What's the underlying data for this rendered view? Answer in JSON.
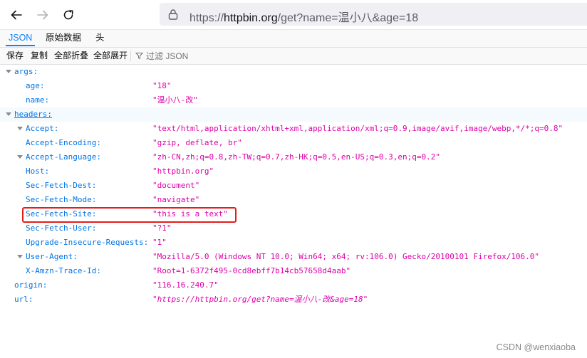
{
  "browser": {
    "url_prefix": "https://",
    "url_host": "httpbin.org",
    "url_path": "/get?name=温小八&age=18"
  },
  "tabs": {
    "json": "JSON",
    "raw": "原始数据",
    "headers": "头"
  },
  "actions": {
    "save": "保存",
    "copy": "复制",
    "collapse_all": "全部折叠",
    "expand_all": "全部展开",
    "filter_placeholder": "过滤 JSON"
  },
  "json": {
    "args_key": "args:",
    "args": [
      {
        "key": "age:",
        "value": "\"18\""
      },
      {
        "key": "name:",
        "value": "\"温小八-改\""
      }
    ],
    "headers_key": "headers:",
    "headers": [
      {
        "key": "Accept:",
        "value": "\"text/html,application/xhtml+xml,application/xml;q=0.9,image/avif,image/webp,*/*;q=0.8\""
      },
      {
        "key": "Accept-Encoding:",
        "value": "\"gzip, deflate, br\""
      },
      {
        "key": "Accept-Language:",
        "value": "\"zh-CN,zh;q=0.8,zh-TW;q=0.7,zh-HK;q=0.5,en-US;q=0.3,en;q=0.2\""
      },
      {
        "key": "Host:",
        "value": "\"httpbin.org\""
      },
      {
        "key": "Sec-Fetch-Dest:",
        "value": "\"document\""
      },
      {
        "key": "Sec-Fetch-Mode:",
        "value": "\"navigate\""
      },
      {
        "key": "Sec-Fetch-Site:",
        "value": "\"this is a text\""
      },
      {
        "key": "Sec-Fetch-User:",
        "value": "\"?1\""
      },
      {
        "key": "Upgrade-Insecure-Requests:",
        "value": "\"1\""
      },
      {
        "key": "User-Agent:",
        "value": "\"Mozilla/5.0 (Windows NT 10.0; Win64; x64; rv:106.0) Gecko/20100101 Firefox/106.0\""
      },
      {
        "key": "X-Amzn-Trace-Id:",
        "value": "\"Root=1-6372f495-0cd8ebff7b14cb57658d4aab\""
      }
    ],
    "origin_key": "origin:",
    "origin_value": "\"116.16.240.7\"",
    "url_key": "url:",
    "url_value": "\"https://httpbin.org/get?name=温小八-改&age=18\""
  },
  "watermark": "CSDN @wenxiaoba",
  "colors": {
    "key": "#0074e8",
    "string": "#dd00a9",
    "accent": "#0a84ff",
    "highlight": "#e51c1c"
  }
}
